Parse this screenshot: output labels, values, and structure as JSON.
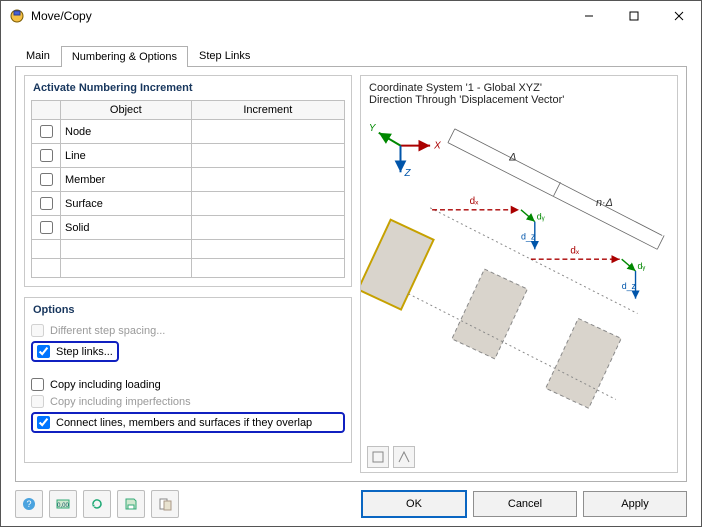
{
  "window": {
    "title": "Move/Copy"
  },
  "tabs": [
    {
      "label": "Main"
    },
    {
      "label": "Numbering & Options"
    },
    {
      "label": "Step Links"
    }
  ],
  "activeTabIndex": 1,
  "numbering": {
    "section_title": "Activate Numbering Increment",
    "cols": {
      "object": "Object",
      "increment": "Increment"
    },
    "rows": [
      {
        "checked": false,
        "object": "Node",
        "increment": ""
      },
      {
        "checked": false,
        "object": "Line",
        "increment": ""
      },
      {
        "checked": false,
        "object": "Member",
        "increment": ""
      },
      {
        "checked": false,
        "object": "Surface",
        "increment": ""
      },
      {
        "checked": false,
        "object": "Solid",
        "increment": ""
      }
    ]
  },
  "options": {
    "section_title": "Options",
    "diff_step": {
      "label": "Different step spacing...",
      "checked": false,
      "enabled": false,
      "highlighted": false
    },
    "step_links": {
      "label": "Step links...",
      "checked": true,
      "enabled": true,
      "highlighted": true
    },
    "copy_loading": {
      "label": "Copy including loading",
      "checked": false,
      "enabled": true,
      "highlighted": false
    },
    "copy_imperf": {
      "label": "Copy including imperfections",
      "checked": false,
      "enabled": false,
      "highlighted": false
    },
    "connect_overlap": {
      "label": "Connect lines, members and surfaces if they overlap",
      "checked": true,
      "enabled": true,
      "highlighted": true
    }
  },
  "preview": {
    "line1": "Coordinate System '1 - Global XYZ'",
    "line2": "Direction Through 'Displacement Vector'",
    "axes": {
      "x": "X",
      "y": "Y",
      "z": "Z"
    },
    "labels": {
      "delta": "Δ",
      "ndelta": "n·Δ",
      "dx": "dₓ",
      "dy": "dᵧ",
      "dz": "d_z"
    }
  },
  "buttons": {
    "ok": "OK",
    "cancel": "Cancel",
    "apply": "Apply"
  },
  "chart_data": {
    "type": "diagram",
    "description": "Schematic illustrating Move/Copy: three displaced rectangles along a direction vector with components dx, dy, dz; total delta Δ and n·Δ shown as dimension lines.",
    "axes": [
      "X",
      "Y",
      "Z"
    ],
    "copies": 3,
    "dimension_labels": [
      "Δ",
      "n·Δ",
      "dₓ",
      "dᵧ",
      "d_z"
    ]
  }
}
